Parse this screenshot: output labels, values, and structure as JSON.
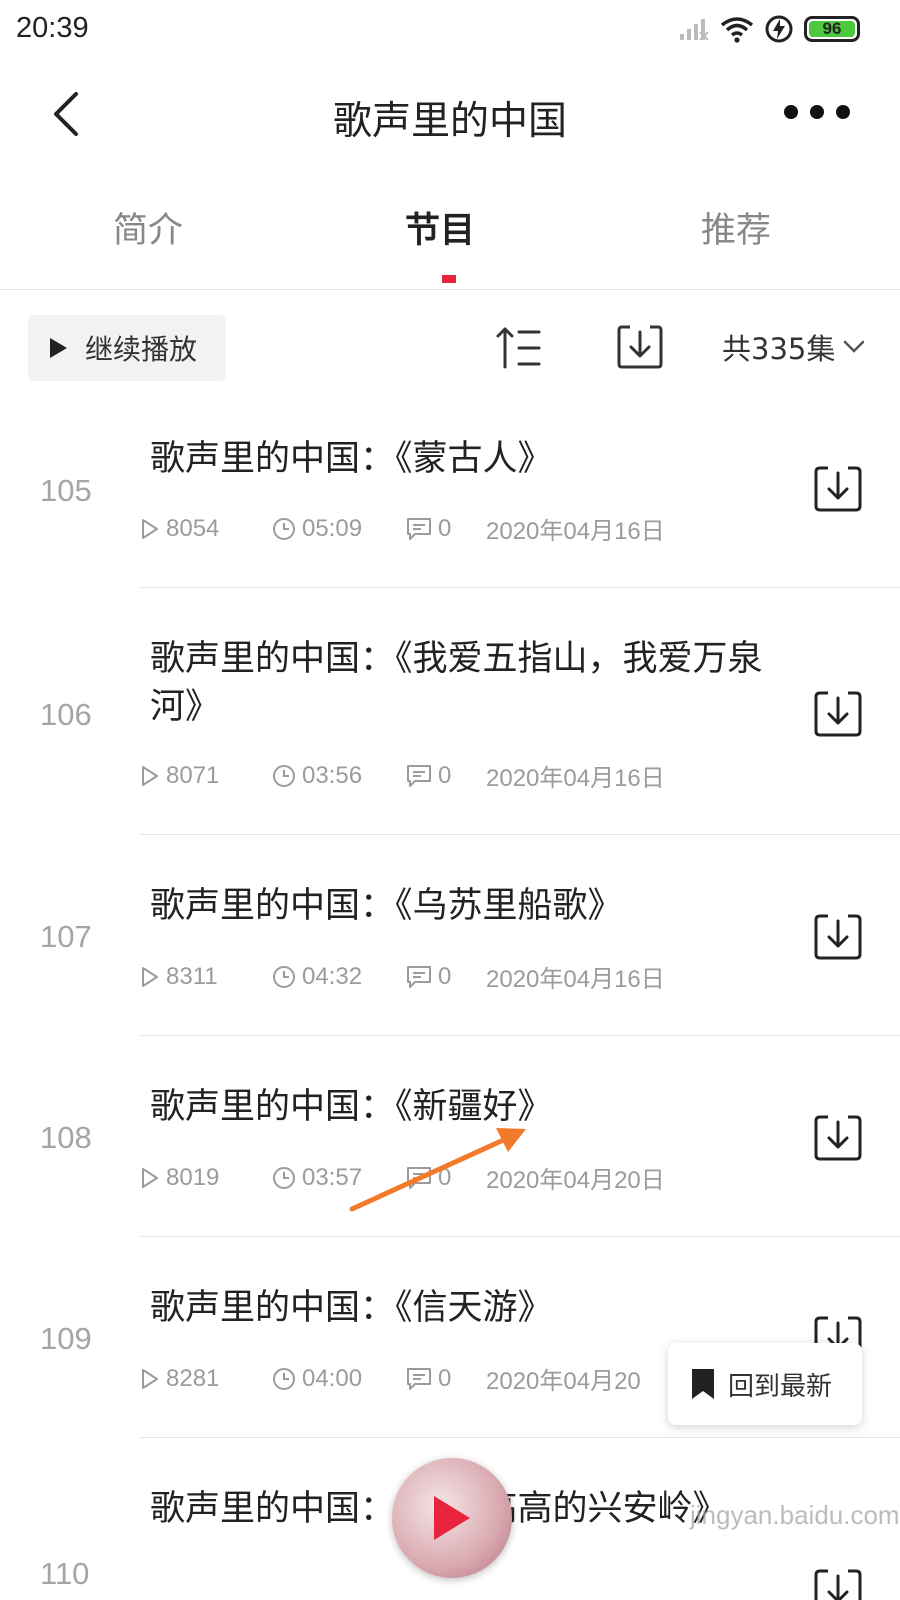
{
  "status_bar": {
    "time": "20:39",
    "battery": "96",
    "icons": [
      "signal-icon",
      "wifi-icon",
      "charging-icon",
      "battery-icon"
    ]
  },
  "nav": {
    "title": "歌声里的中国",
    "back_icon": "chevron-left-icon",
    "more_icon": "more-dots-icon"
  },
  "tabs": [
    {
      "label": "简介",
      "active": false
    },
    {
      "label": "节目",
      "active": true
    },
    {
      "label": "推荐",
      "active": false
    }
  ],
  "toolbar": {
    "continue_label": "继续播放",
    "sort_icon": "sort-icon",
    "download_icon": "download-icon",
    "episode_count": "共335集"
  },
  "episodes": [
    {
      "number": "105",
      "title": "歌声里的中国：《蒙古人》",
      "plays": "8054",
      "duration": "05:09",
      "comments": "0",
      "date": "2020年04月16日"
    },
    {
      "number": "106",
      "title": "歌声里的中国：《我爱五指山，我爱万泉河》",
      "plays": "8071",
      "duration": "03:56",
      "comments": "0",
      "date": "2020年04月16日"
    },
    {
      "number": "107",
      "title": "歌声里的中国：《乌苏里船歌》",
      "plays": "8311",
      "duration": "04:32",
      "comments": "0",
      "date": "2020年04月16日"
    },
    {
      "number": "108",
      "title": "歌声里的中国：《新疆好》",
      "plays": "8019",
      "duration": "03:57",
      "comments": "0",
      "date": "2020年04月20日"
    },
    {
      "number": "109",
      "title": "歌声里的中国：《信天游》",
      "plays": "8281",
      "duration": "04:00",
      "comments": "0",
      "date": "2020年04月20"
    },
    {
      "number": "110",
      "title": "歌声里的中国：《上这高高的兴安岭》"
    }
  ],
  "floating": {
    "back_to_latest": "回到最新"
  },
  "watermark": "jingyan.baidu.com",
  "colors": {
    "accent": "#e8243c",
    "annotation_arrow": "#f27a2a",
    "battery": "#4cc93f"
  }
}
